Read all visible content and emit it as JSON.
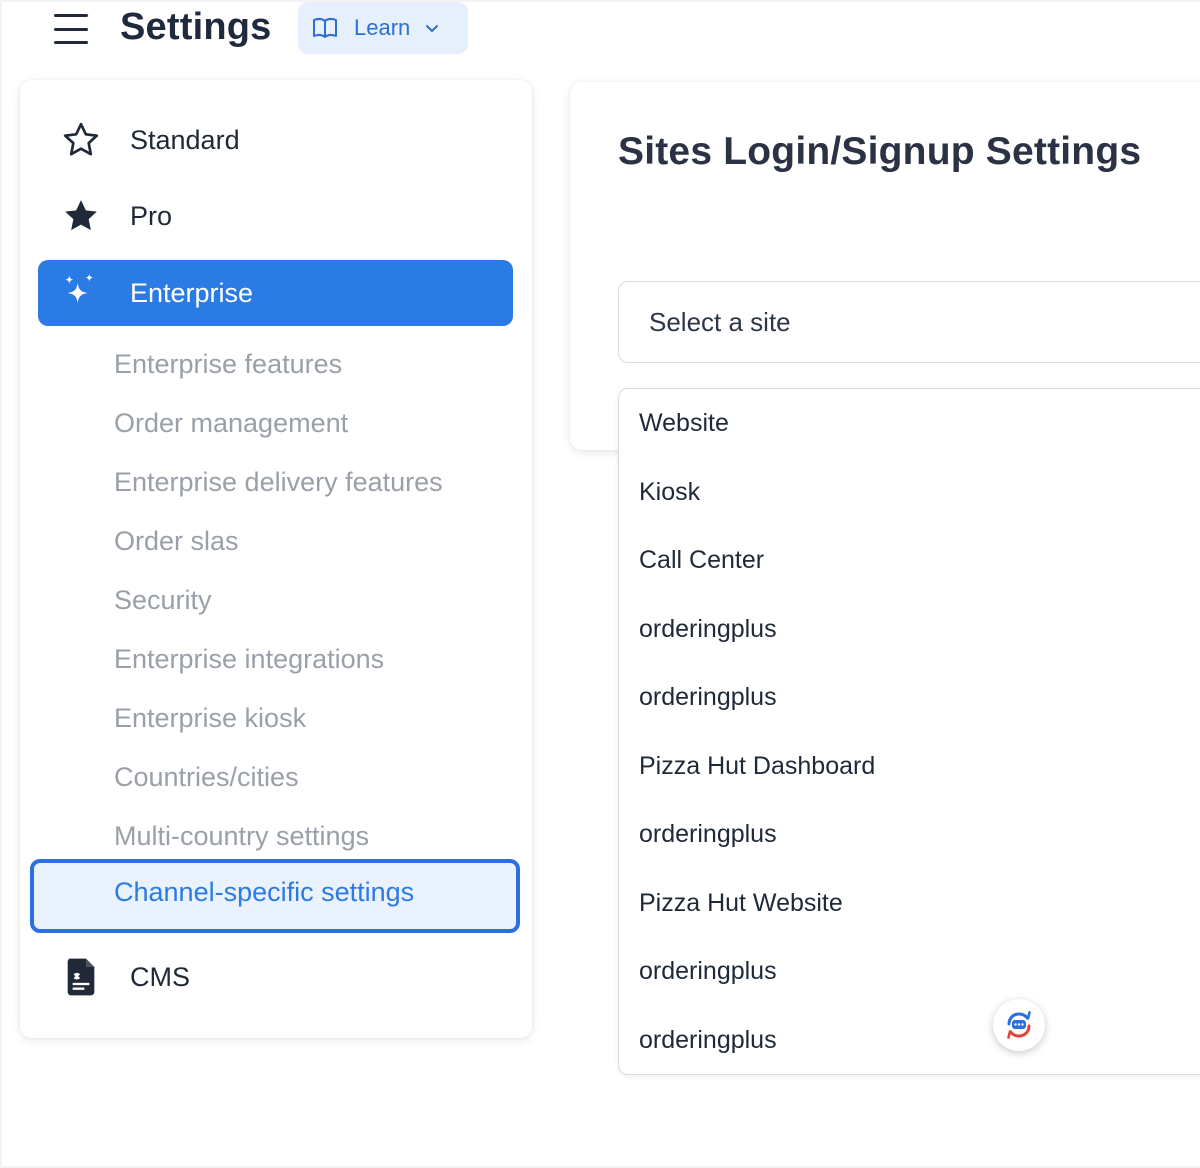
{
  "header": {
    "title": "Settings",
    "learn_label": "Learn"
  },
  "sidebar": {
    "top_items": [
      {
        "label": "Standard",
        "icon": "star-outline-icon"
      },
      {
        "label": "Pro",
        "icon": "star-filled-icon"
      },
      {
        "label": "Enterprise",
        "icon": "sparkles-icon",
        "active": true
      }
    ],
    "sub_items": [
      "Enterprise features",
      "Order management",
      "Enterprise delivery features",
      "Order slas",
      "Security",
      "Enterprise integrations",
      "Enterprise kiosk",
      "Countries/cities",
      "Multi-country settings",
      "Channel-specific settings"
    ],
    "selected_sub_item": "Channel-specific settings",
    "bottom_item": {
      "label": "CMS",
      "icon": "document-icon"
    }
  },
  "main": {
    "title": "Sites Login/Signup Settings",
    "site_select_placeholder": "Select a site",
    "site_options": [
      "Website",
      "Kiosk",
      "Call Center",
      "orderingplus",
      "orderingplus",
      "Pizza Hut Dashboard",
      "orderingplus",
      "Pizza Hut Website",
      "orderingplus",
      "orderingplus"
    ]
  },
  "colors": {
    "accent": "#2b7be4",
    "learn_bg": "#e6effc",
    "sub_item_text": "#9aa0a8",
    "selected_bg": "#eaf2fe"
  },
  "icons": {
    "menu": "hamburger-menu-icon",
    "learn": "book-open-icon",
    "learn_chevron": "chevron-down-icon",
    "chat_widget": "chat-sync-icon"
  }
}
